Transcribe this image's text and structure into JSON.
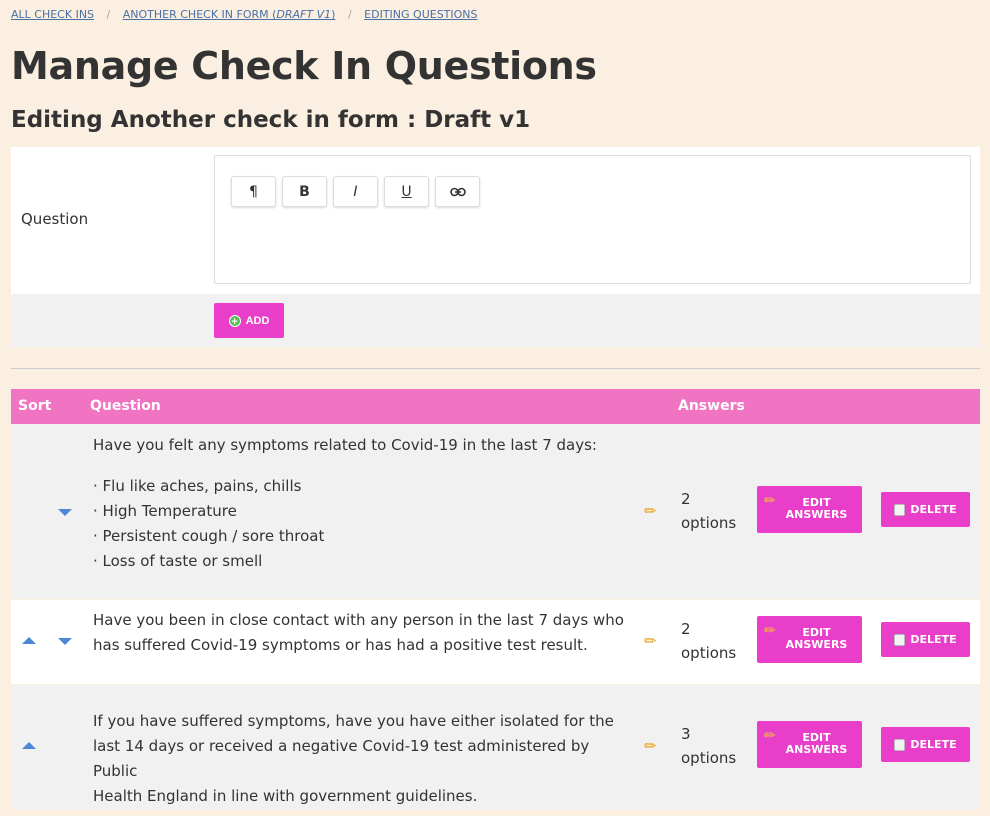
{
  "breadcrumb": {
    "item1": "ALL CHECK INS",
    "item2_prefix": "ANOTHER CHECK IN FORM (",
    "item2_italic": "DRAFT V1",
    "item2_suffix": ")",
    "item3": "EDITING QUESTIONS"
  },
  "page_title": "Manage Check In Questions",
  "subtitle": "Editing Another check in form : Draft v1",
  "form": {
    "question_label": "Question",
    "toolbar": {
      "paragraph": "¶",
      "bold": "B",
      "italic": "I",
      "underline": "U",
      "link": "link-icon"
    },
    "add_label": "ADD"
  },
  "table": {
    "headers": {
      "sort": "Sort",
      "question": "Question",
      "answers": "Answers"
    },
    "rows": [
      {
        "question_intro": "Have you felt any symptoms related to Covid-19 in the last 7 days:",
        "question_lines": [
          "· Flu like aches, pains, chills",
          "· High Temperature",
          "· Persistent cough / sore throat",
          "· Loss of taste or smell"
        ],
        "answers_count": "2",
        "answers_unit": "options",
        "edit_label_1": "EDIT",
        "edit_label_2": "ANSWERS",
        "delete_label": "DELETE"
      },
      {
        "question_line1": "Have you been in close contact with any person in the last 7 days who",
        "question_line2": "has suffered Covid-19 symptoms or has had a positive test result.",
        "answers_count": "2",
        "answers_unit": "options",
        "edit_label_1": "EDIT",
        "edit_label_2": "ANSWERS",
        "delete_label": "DELETE"
      },
      {
        "question_line1": "If you have suffered symptoms, have you have either isolated for the",
        "question_line2": "last 14 days or received a negative Covid-19 test administered by Public",
        "question_line3": "Health England in line with government guidelines.",
        "answers_count": "3",
        "answers_unit": "options",
        "edit_label_1": "EDIT",
        "edit_label_2": "ANSWERS",
        "delete_label": "DELETE"
      }
    ]
  },
  "colors": {
    "background": "#fbefe1",
    "accent": "#e83ec9",
    "table_header": "#f074c2",
    "link": "#4a6fa5"
  }
}
